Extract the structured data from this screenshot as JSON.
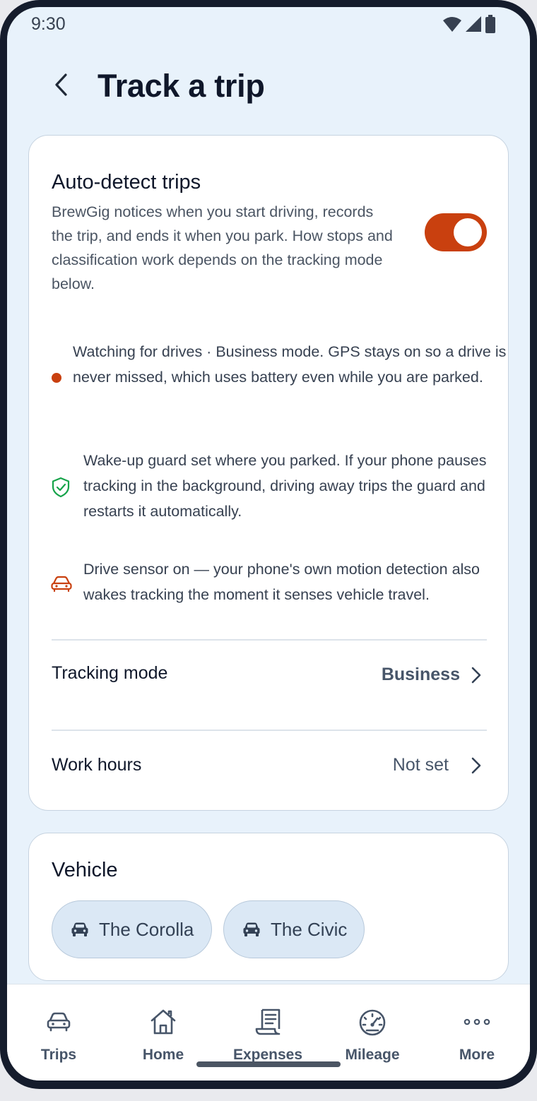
{
  "status_bar": {
    "time": "9:30"
  },
  "header": {
    "title": "Track a trip"
  },
  "auto_detect": {
    "title": "Auto-detect trips",
    "description": "BrewGig notices when you start driving, records the trip, and ends it when you park. How stops and classification work depends on the tracking mode below.",
    "toggle_on": true,
    "info_items": [
      {
        "icon": "status-dot",
        "text": "Watching for drives · Business mode. GPS stays on so a drive is never missed, which uses battery even while you are parked."
      },
      {
        "icon": "shield-check-icon",
        "text": "Wake-up guard set where you parked. If your phone pauses tracking in the background, driving away trips the guard and restarts it automatically."
      },
      {
        "icon": "car-alert-icon",
        "text": "Drive sensor on — your phone's own motion detection also wakes tracking the moment it senses vehicle travel."
      }
    ],
    "rows": [
      {
        "label": "Tracking mode",
        "value": "Business"
      },
      {
        "label": "Work hours",
        "value": "Not set"
      }
    ]
  },
  "vehicle": {
    "title": "Vehicle",
    "chips": [
      {
        "label": "The Corolla"
      },
      {
        "label": "The Civic"
      }
    ]
  },
  "bottom_nav": [
    {
      "label": "Trips",
      "icon": "car-icon"
    },
    {
      "label": "Home",
      "icon": "home-icon"
    },
    {
      "label": "Expenses",
      "icon": "receipt-icon"
    },
    {
      "label": "Mileage",
      "icon": "speedometer-icon"
    },
    {
      "label": "More",
      "icon": "more-dots-icon"
    }
  ],
  "colors": {
    "accent": "#c9400f",
    "background": "#e8f2fb",
    "shield": "#16a34a"
  }
}
